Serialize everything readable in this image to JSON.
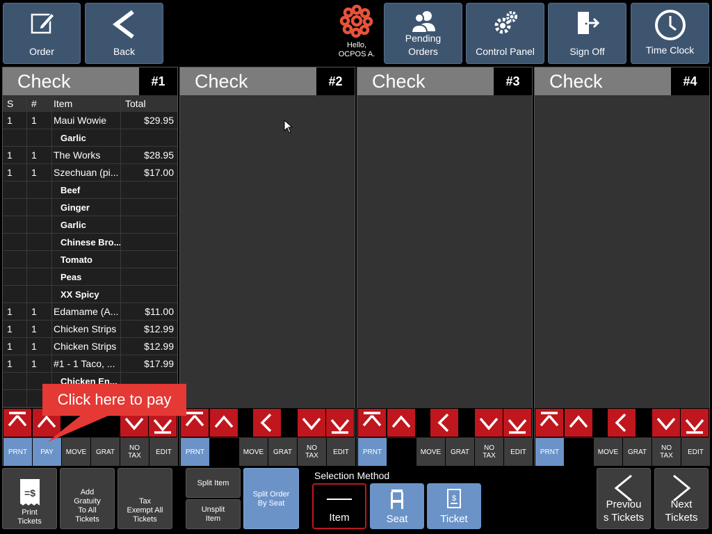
{
  "top_bar": {
    "order_label": "Order",
    "back_label": "Back",
    "greeting_line1": "Hello,",
    "greeting_line2": "OCPOS A.",
    "pending_line1": "Pending",
    "pending_line2": "Orders",
    "control_panel_label": "Control Panel",
    "sign_off_label": "Sign Off",
    "time_clock_label": "Time Clock"
  },
  "checks": [
    {
      "title": "Check",
      "number": "#1"
    },
    {
      "title": "Check",
      "number": "#2"
    },
    {
      "title": "Check",
      "number": "#3"
    },
    {
      "title": "Check",
      "number": "#4"
    }
  ],
  "table_headers": {
    "seat": "S",
    "qty": "#",
    "item": "Item",
    "total": "Total"
  },
  "check1_rows": [
    {
      "seat": "1",
      "qty": "1",
      "item": "Maui Wowie",
      "total": "$29.95",
      "modifier": false
    },
    {
      "seat": "",
      "qty": "",
      "item": "Garlic",
      "total": "",
      "modifier": true
    },
    {
      "seat": "1",
      "qty": "1",
      "item": "The Works",
      "total": "$28.95",
      "modifier": false
    },
    {
      "seat": "1",
      "qty": "1",
      "item": "Szechuan (pi...",
      "total": "$17.00",
      "modifier": false
    },
    {
      "seat": "",
      "qty": "",
      "item": "Beef",
      "total": "",
      "modifier": true
    },
    {
      "seat": "",
      "qty": "",
      "item": "Ginger",
      "total": "",
      "modifier": true
    },
    {
      "seat": "",
      "qty": "",
      "item": "Garlic",
      "total": "",
      "modifier": true
    },
    {
      "seat": "",
      "qty": "",
      "item": "Chinese Bro...",
      "total": "",
      "modifier": true
    },
    {
      "seat": "",
      "qty": "",
      "item": "Tomato",
      "total": "",
      "modifier": true
    },
    {
      "seat": "",
      "qty": "",
      "item": "Peas",
      "total": "",
      "modifier": true
    },
    {
      "seat": "",
      "qty": "",
      "item": "XX Spicy",
      "total": "",
      "modifier": true
    },
    {
      "seat": "1",
      "qty": "1",
      "item": "Edamame (A...",
      "total": "$11.00",
      "modifier": false
    },
    {
      "seat": "1",
      "qty": "1",
      "item": "Chicken Strips",
      "total": "$12.99",
      "modifier": false
    },
    {
      "seat": "1",
      "qty": "1",
      "item": "Chicken Strips",
      "total": "$12.99",
      "modifier": false
    },
    {
      "seat": "1",
      "qty": "1",
      "item": "#1 - 1 Taco, ...",
      "total": "$17.99",
      "modifier": false
    },
    {
      "seat": "",
      "qty": "",
      "item": "Chicken En...",
      "total": "",
      "modifier": true
    },
    {
      "seat": "",
      "qty": "",
      "item": "",
      "total": "",
      "modifier": false
    }
  ],
  "action_labels": {
    "print": "PRNT",
    "pay": "PAY",
    "move": "MOVE",
    "grat": "GRAT",
    "no_tax_1": "NO",
    "no_tax_2": "TAX",
    "edit": "EDIT"
  },
  "tooltip": {
    "text": "Click here to pay"
  },
  "bottom": {
    "print_tickets_1": "Print",
    "print_tickets_2": "Tickets",
    "add_gratuity": [
      "Add",
      "Gratuity",
      "To All",
      "Tickets"
    ],
    "tax_exempt": [
      "Tax",
      "Exempt All",
      "Tickets"
    ],
    "split_item": "Split Item",
    "unsplit_1": "Unsplit",
    "unsplit_2": "Item",
    "split_by_seat_1": "Split Order",
    "split_by_seat_2": "By Seat",
    "selection_method_label": "Selection Method",
    "item_label": "Item",
    "seat_label": "Seat",
    "ticket_label": "Ticket",
    "prev_1": "Previou",
    "prev_2": "s Tickets",
    "next_1": "Next",
    "next_2": "Tickets"
  },
  "colors": {
    "accent_red": "#c0161d",
    "top_button": "#3e5570",
    "active_blue": "#6b93c8",
    "tooltip": "#e53935"
  }
}
